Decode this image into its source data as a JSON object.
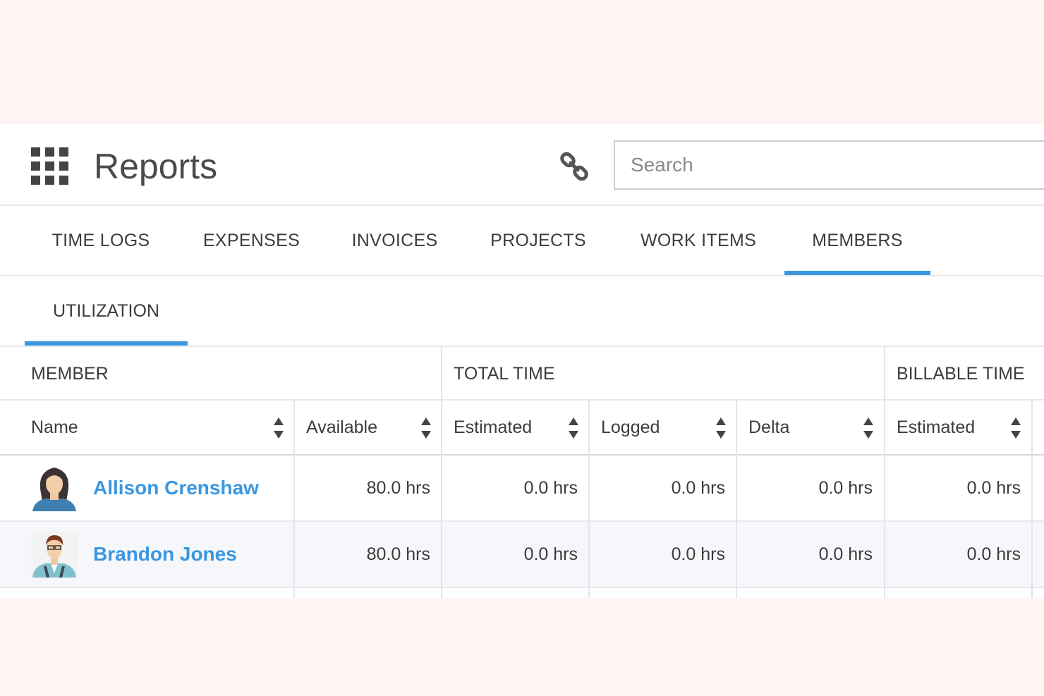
{
  "header": {
    "title": "Reports",
    "apps_icon": "apps-grid-icon",
    "link_icon": "link-icon",
    "search_placeholder": "Search"
  },
  "tabs": [
    {
      "label": "TIME LOGS",
      "active": false
    },
    {
      "label": "EXPENSES",
      "active": false
    },
    {
      "label": "INVOICES",
      "active": false
    },
    {
      "label": "PROJECTS",
      "active": false
    },
    {
      "label": "WORK ITEMS",
      "active": false
    },
    {
      "label": "MEMBERS",
      "active": true
    }
  ],
  "subtabs": [
    {
      "label": "UTILIZATION",
      "active": true
    }
  ],
  "table": {
    "groups": [
      "MEMBER",
      "TOTAL TIME",
      "BILLABLE TIME"
    ],
    "columns": [
      "Name",
      "Available",
      "Estimated",
      "Logged",
      "Delta",
      "Estimated"
    ],
    "rows": [
      {
        "name": "Allison Crenshaw",
        "available": "80.0 hrs",
        "estimated": "0.0 hrs",
        "logged": "0.0 hrs",
        "delta": "0.0 hrs",
        "billable_estimated": "0.0 hrs"
      },
      {
        "name": "Brandon Jones",
        "available": "80.0 hrs",
        "estimated": "0.0 hrs",
        "logged": "0.0 hrs",
        "delta": "0.0 hrs",
        "billable_estimated": "0.0 hrs"
      }
    ]
  },
  "colors": {
    "accent": "#3a97e0",
    "page_background": "#fff5f5",
    "alt_row": "#f6f7fb"
  }
}
